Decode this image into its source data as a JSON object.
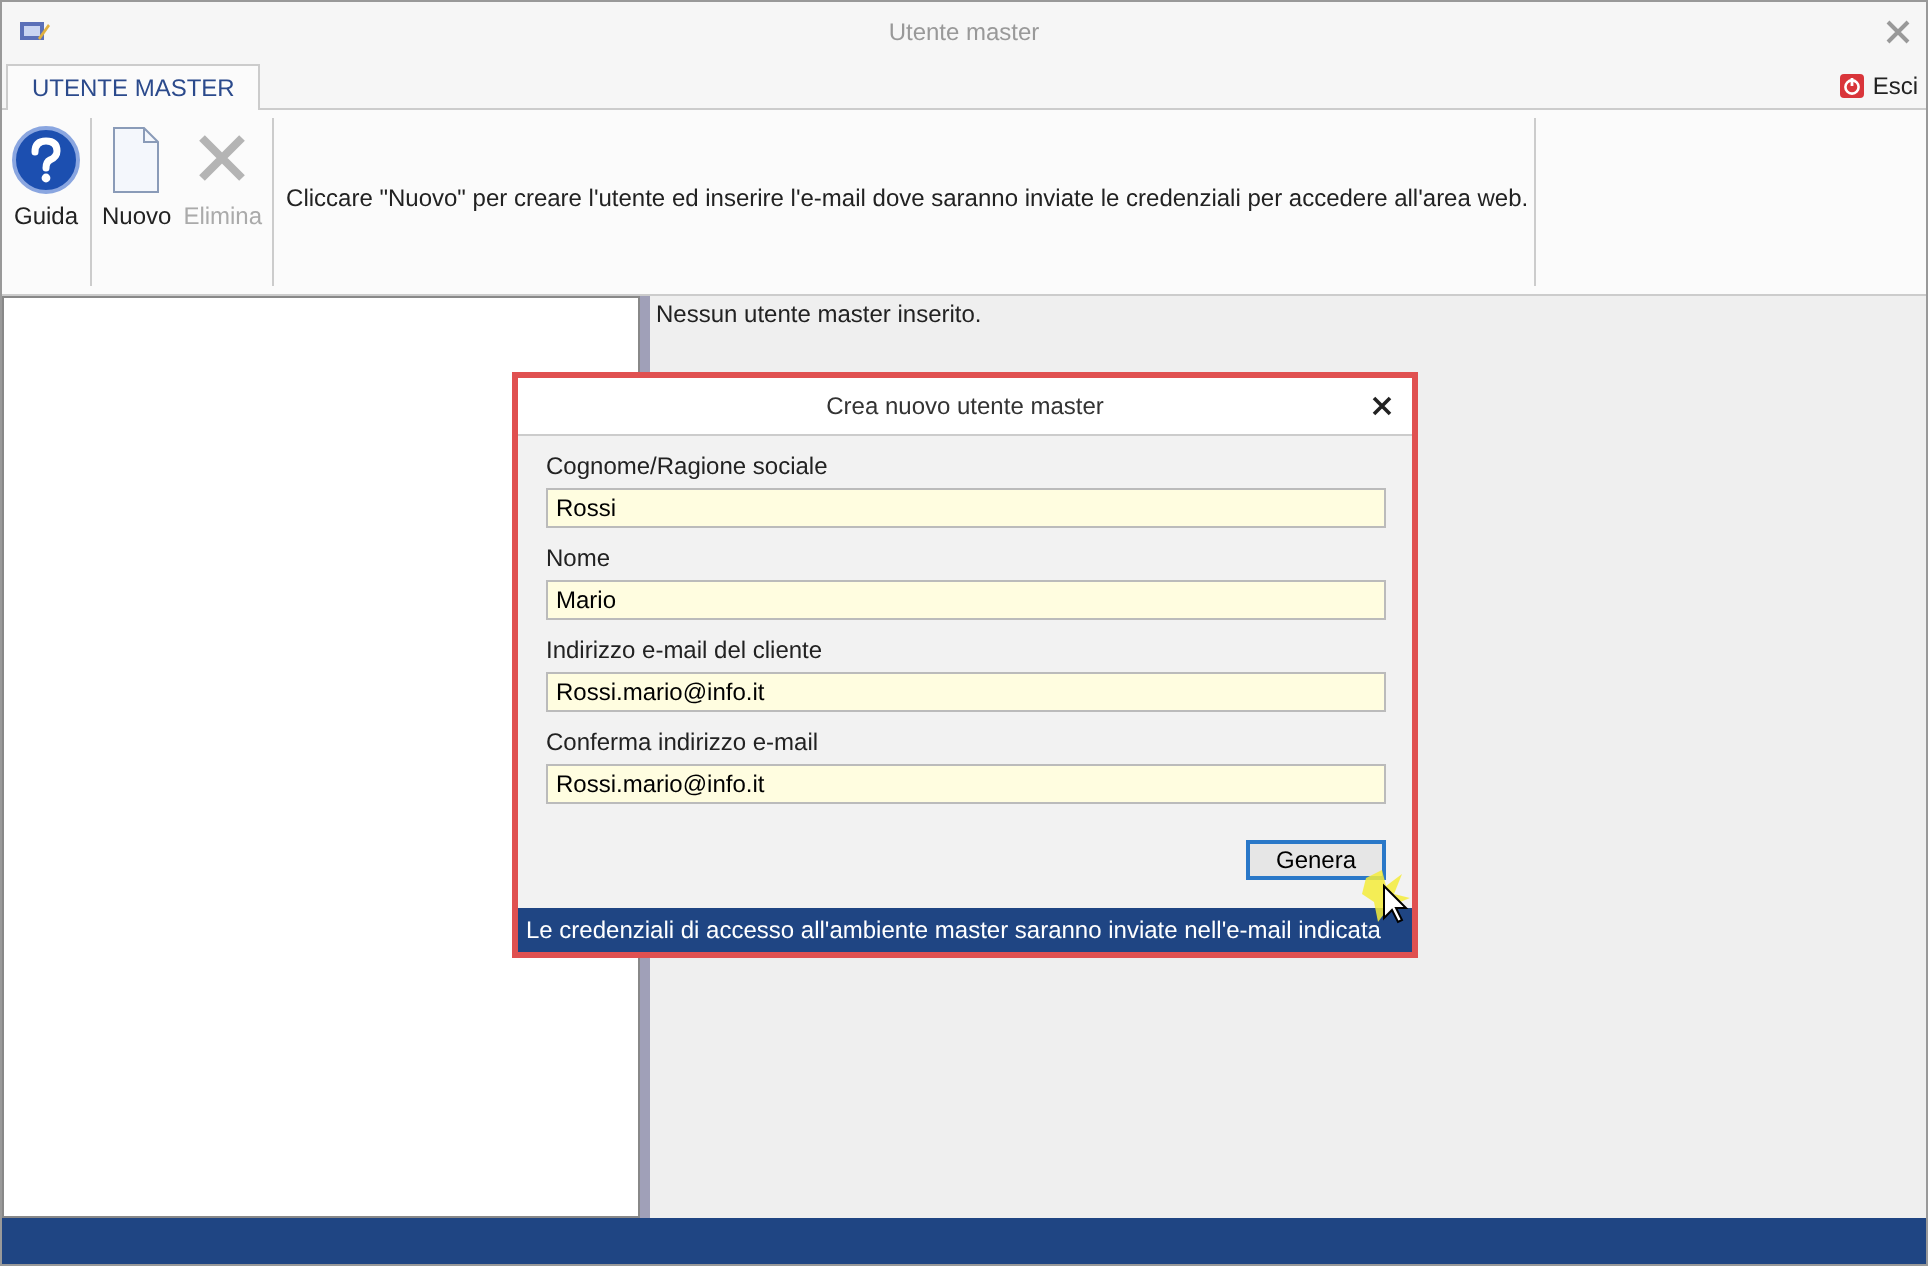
{
  "window": {
    "title": "Utente master"
  },
  "tabs": [
    {
      "label": "UTENTE MASTER",
      "selected": true
    }
  ],
  "exit_button": {
    "label": "Esci"
  },
  "ribbon": {
    "groups": [
      {
        "buttons": [
          {
            "label": "Guida",
            "kind": "help",
            "disabled": false
          }
        ]
      },
      {
        "buttons": [
          {
            "label": "Nuovo",
            "kind": "new",
            "disabled": false
          },
          {
            "label": "Elimina",
            "kind": "delete",
            "disabled": true
          }
        ]
      }
    ],
    "hint": "Cliccare \"Nuovo\" per creare l'utente ed inserire l'e-mail dove saranno inviate le credenziali per accedere all'area web."
  },
  "content": {
    "message": "Nessun utente master inserito."
  },
  "dialog": {
    "title": "Crea nuovo utente master",
    "fields": [
      {
        "label": "Cognome/Ragione sociale",
        "value": "Rossi"
      },
      {
        "label": "Nome",
        "value": "Mario"
      },
      {
        "label": "Indirizzo e-mail del cliente",
        "value": "Rossi.mario@info.it"
      },
      {
        "label": "Conferma indirizzo e-mail",
        "value": "Rossi.mario@info.it"
      }
    ],
    "button": "Genera",
    "footer": "Le credenziali di accesso all'ambiente master saranno inviate nell'e-mail indicata"
  }
}
